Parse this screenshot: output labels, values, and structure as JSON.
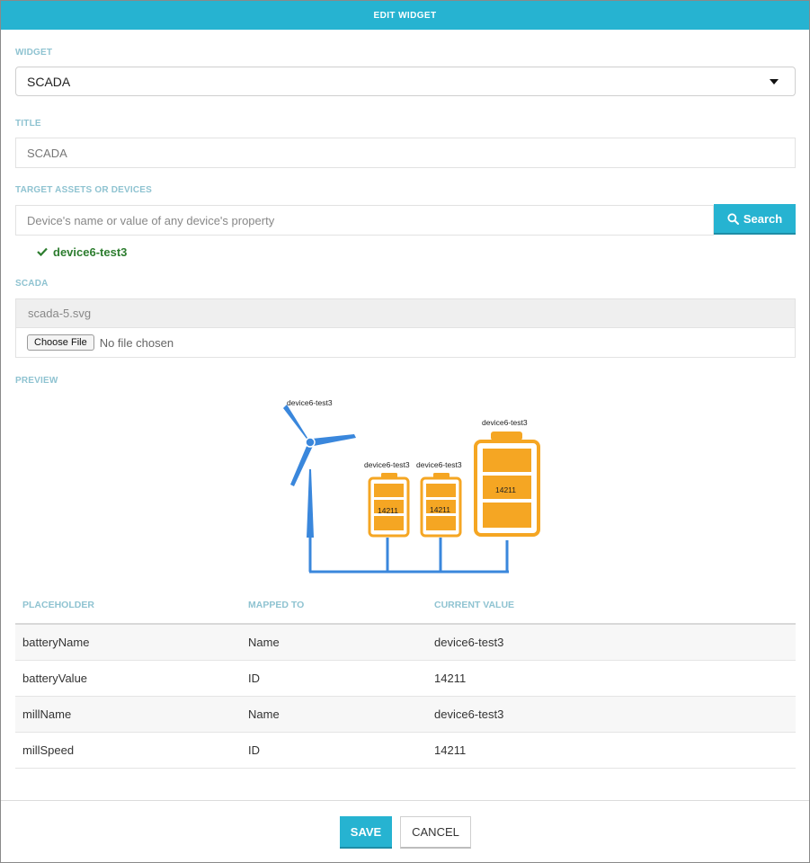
{
  "header": {
    "title": "EDIT WIDGET"
  },
  "widget": {
    "label": "WIDGET",
    "value": "SCADA"
  },
  "title_field": {
    "label": "TITLE",
    "value": "SCADA"
  },
  "targets": {
    "label": "TARGET ASSETS OR DEVICES",
    "placeholder": "Device's name or value of any device's property",
    "search_label": "Search",
    "selected": [
      "device6-test3"
    ]
  },
  "scada": {
    "label": "SCADA",
    "file_name": "scada-5.svg",
    "choose_label": "Choose File",
    "no_file_label": "No file chosen"
  },
  "preview": {
    "label": "PREVIEW",
    "mill_name": "device6-test3",
    "batteries": [
      {
        "name": "device6-test3",
        "value": "14211"
      },
      {
        "name": "device6-test3",
        "value": "14211"
      },
      {
        "name": "device6-test3",
        "value": "14211"
      }
    ],
    "colors": {
      "mill": "#3a87dc",
      "battery": "#f5a623",
      "wire": "#3a87dc"
    }
  },
  "table": {
    "headers": [
      "PLACEHOLDER",
      "MAPPED TO",
      "CURRENT VALUE"
    ],
    "rows": [
      {
        "placeholder": "batteryName",
        "mapped": "Name",
        "value": "device6-test3"
      },
      {
        "placeholder": "batteryValue",
        "mapped": "ID",
        "value": "14211"
      },
      {
        "placeholder": "millName",
        "mapped": "Name",
        "value": "device6-test3"
      },
      {
        "placeholder": "millSpeed",
        "mapped": "ID",
        "value": "14211"
      }
    ]
  },
  "footer": {
    "save_label": "SAVE",
    "cancel_label": "CANCEL"
  },
  "colors": {
    "accent": "#26b3d1",
    "section_label": "#8fc3d1",
    "success": "#2d7d2f"
  }
}
